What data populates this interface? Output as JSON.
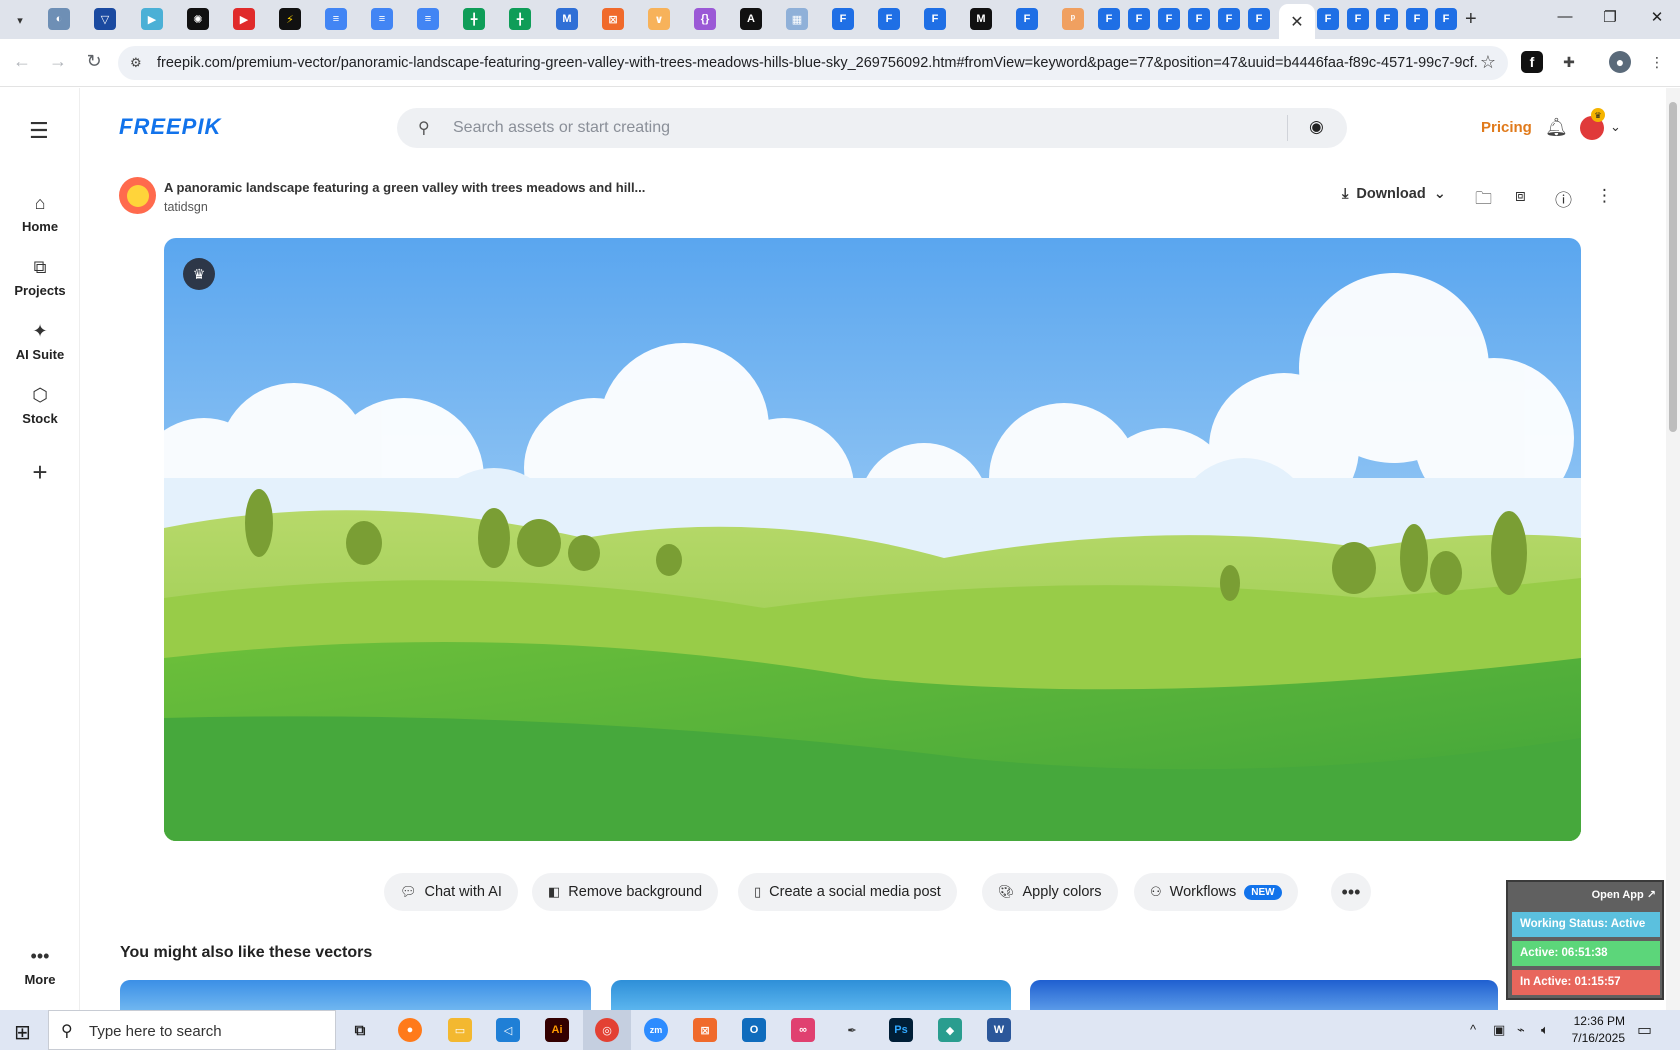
{
  "browser": {
    "url": "freepik.com/premium-vector/panoramic-landscape-featuring-green-valley-with-trees-meadows-hills-blue-sky_269756092.htm#fromView=keyword&page=77&position=47&uuid=b4446faa-f89c-4571-99c7-9cf...",
    "active_tab_close": "✕",
    "new_tab": "+"
  },
  "header": {
    "logo": "FREEPIK",
    "search_placeholder": "Search assets or start creating",
    "pricing": "Pricing"
  },
  "rail": {
    "items": [
      {
        "label": "Home",
        "icon": "home-icon"
      },
      {
        "label": "Projects",
        "icon": "projects-icon"
      },
      {
        "label": "AI Suite",
        "icon": "sparkle-icon"
      },
      {
        "label": "Stock",
        "icon": "stock-icon"
      }
    ],
    "more": "More"
  },
  "asset": {
    "title": "A panoramic landscape featuring a green valley with trees meadows and hill...",
    "author": "tatidsgn",
    "download": "Download"
  },
  "actions": {
    "chat": "Chat with AI",
    "remove_bg": "Remove background",
    "social": "Create a social media post",
    "colors": "Apply colors",
    "workflows": "Workflows",
    "new_badge": "NEW"
  },
  "related": {
    "title": "You might also like these vectors"
  },
  "widget": {
    "open_app": "Open App ↗",
    "status": "Working Status: Active",
    "active": "Active: 06:51:38",
    "inactive": "In Active: 01:15:57"
  },
  "taskbar": {
    "search_text": "Type here to search",
    "time": "12:36 PM",
    "date": "7/16/2025"
  },
  "colors": {
    "brand": "#1273eb",
    "pricing": "#e07a1b",
    "status_active": "#5bc0de",
    "active_green": "#5cd67a",
    "inactive_red": "#e8665c"
  }
}
